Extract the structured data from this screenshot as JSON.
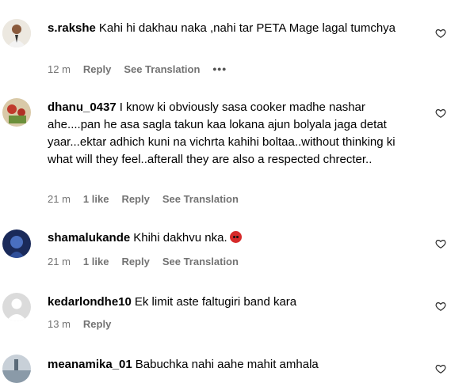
{
  "comments": [
    {
      "username": "s.rakshe",
      "text": "Kahi hi dakhau naka ,nahi tar PETA Mage lagal tumchya",
      "time": "12 m",
      "reply_label": "Reply",
      "translate_label": "See Translation",
      "more_label": "•••"
    },
    {
      "username": "dhanu_0437",
      "text": "I know ki obviously sasa cooker madhe nashar ahe....pan he asa sagla takun kaa lokana ajun bolyala jaga detat yaar...ektar adhich kuni na vichrta kahihi boltaa..without thinking ki what will they feel..afterall they are also a respected chrecter..",
      "time": "21 m",
      "likes": "1 like",
      "reply_label": "Reply",
      "translate_label": "See Translation"
    },
    {
      "username": "shamalukande",
      "text": "Khihi dakhvu nka.",
      "time": "21 m",
      "likes": "1 like",
      "reply_label": "Reply",
      "translate_label": "See Translation"
    },
    {
      "username": "kedarlondhe10",
      "text": "Ek limit aste faltugiri band kara",
      "time": "13 m",
      "reply_label": "Reply"
    },
    {
      "username": "meanamika_01",
      "text": "Babuchka nahi aahe mahit amhala"
    }
  ],
  "colors": {
    "meta_text": "#737373",
    "emoji_angry": "#d62a2a"
  }
}
